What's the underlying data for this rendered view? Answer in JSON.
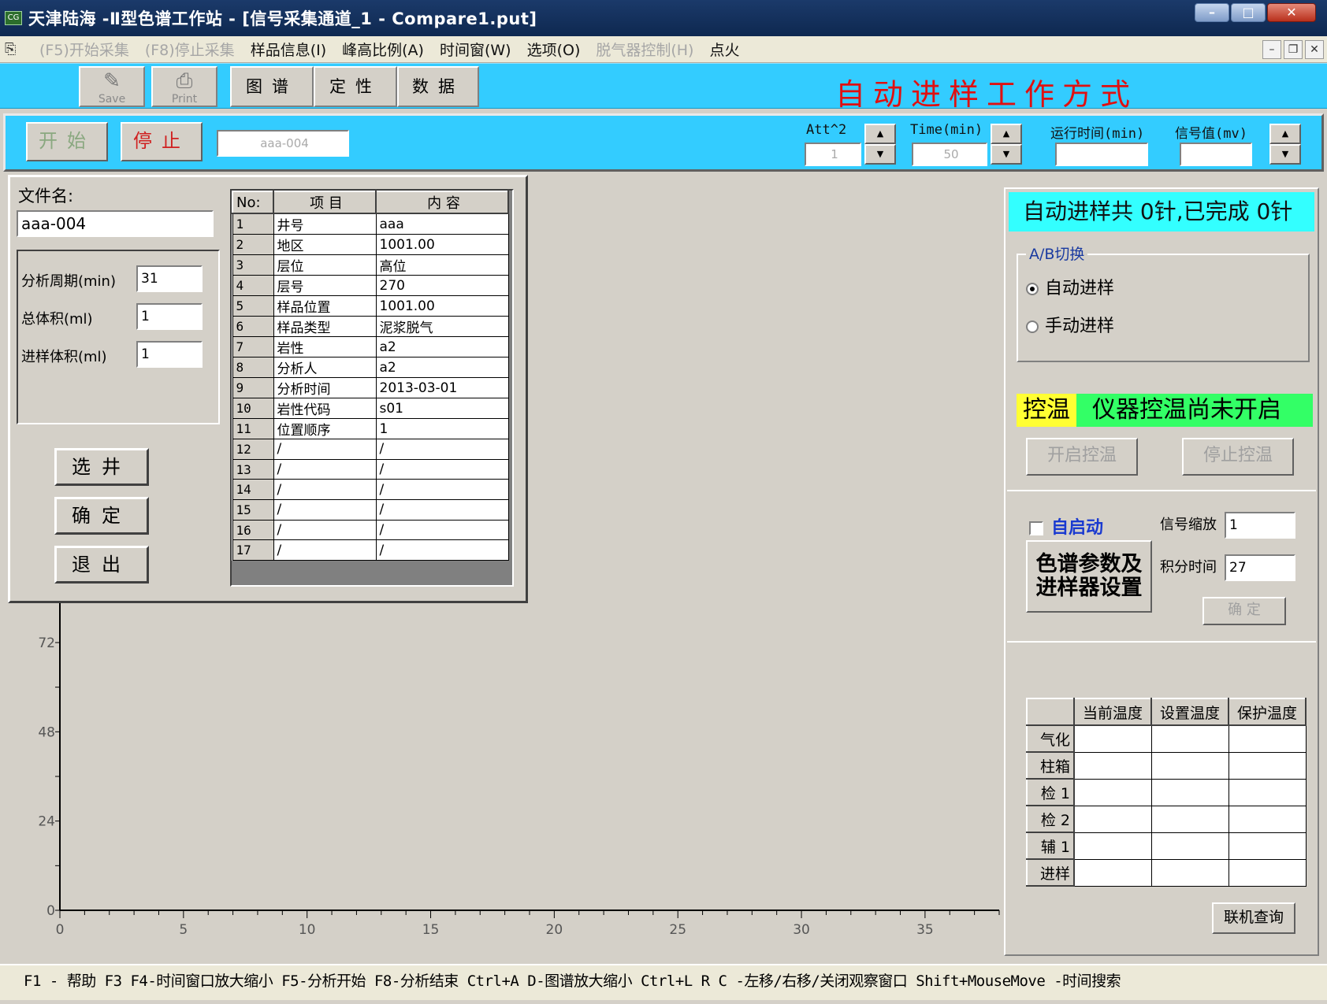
{
  "window": {
    "title": "天津陆海 -Ⅱ型色谱工作站 - [信号采集通道_1 - Compare1.put]",
    "app_icon": "CG"
  },
  "menu": {
    "items": [
      {
        "label": "(F5)开始采集",
        "disabled": true
      },
      {
        "label": "(F8)停止采集",
        "disabled": true
      },
      {
        "label": "样品信息(I)",
        "disabled": false
      },
      {
        "label": "峰高比例(A)",
        "disabled": false
      },
      {
        "label": "时间窗(W)",
        "disabled": false
      },
      {
        "label": "选项(O)",
        "disabled": false
      },
      {
        "label": "脱气器控制(H)",
        "disabled": true
      },
      {
        "label": "点火",
        "disabled": false
      }
    ]
  },
  "toolbar": {
    "save_label": "Save",
    "print_label": "Print",
    "tabs": [
      "图谱",
      "定性",
      "数据"
    ],
    "mode_title": "自动进样工作方式"
  },
  "control": {
    "start_label": "开始",
    "stop_label": "停止",
    "sample_name": "aaa-004",
    "att_label": "Att^2",
    "att_value": "1",
    "time_label": "Time(min)",
    "time_value": "50",
    "run_time_label": "运行时间(min)",
    "run_time_value": "",
    "signal_label": "信号值(mv)",
    "signal_value": ""
  },
  "file_panel": {
    "filename_label": "文件名:",
    "filename_value": "aaa-004",
    "period_label": "分析周期(min)",
    "period_value": "31",
    "total_volume_label": "总体积(ml)",
    "total_volume_value": "1",
    "inject_volume_label": "进样体积(ml)",
    "inject_volume_value": "1",
    "select_well_label": "选井",
    "confirm_label": "确定",
    "exit_label": "退出"
  },
  "info_table": {
    "headers": [
      "No:",
      "项   目",
      "内     容"
    ],
    "rows": [
      [
        "1",
        "井号",
        "aaa"
      ],
      [
        "2",
        "地区",
        "1001.00"
      ],
      [
        "3",
        "层位",
        "高位"
      ],
      [
        "4",
        "层号",
        "270"
      ],
      [
        "5",
        "样品位置",
        "1001.00"
      ],
      [
        "6",
        "样品类型",
        "泥浆脱气"
      ],
      [
        "7",
        "岩性",
        "a2"
      ],
      [
        "8",
        "分析人",
        "a2"
      ],
      [
        "9",
        "分析时间",
        "2013-03-01"
      ],
      [
        "10",
        "岩性代码",
        "s01"
      ],
      [
        "11",
        "位置顺序",
        "1"
      ],
      [
        "12",
        "/",
        "/"
      ],
      [
        "13",
        "/",
        "/"
      ],
      [
        "14",
        "/",
        "/"
      ],
      [
        "15",
        "/",
        "/"
      ],
      [
        "16",
        "/",
        "/"
      ],
      [
        "17",
        "/",
        "/"
      ]
    ]
  },
  "chart_data": {
    "type": "line",
    "x_ticks": [
      "0",
      "5",
      "10",
      "15",
      "20",
      "25",
      "30",
      "35"
    ],
    "y_ticks": [
      "0",
      "24",
      "48",
      "72"
    ],
    "xlim": [
      0,
      38
    ],
    "ylim": [
      0,
      72
    ],
    "series": []
  },
  "right_panel": {
    "progress_text": "自动进样共 0针,已完成 0针",
    "ab_group_label": "A/B切换",
    "auto_inject_label": "自动进样",
    "manual_inject_label": "手动进样",
    "auto_inject_selected": true,
    "temp_key": "控温",
    "temp_status": "仪器控温尚未开启",
    "start_temp_label": "开启控温",
    "stop_temp_label": "停止控温",
    "autostart_label": "自启动",
    "autostart_checked": false,
    "settings_label_1": "色谱参数及",
    "settings_label_2": "进样器设置",
    "signal_scale_label": "信号缩放",
    "signal_scale_value": "1",
    "integral_time_label": "积分时间",
    "integral_time_value": "27",
    "ok_label": "确 定",
    "online_query_label": "联机查询",
    "temp_table": {
      "headers": [
        "",
        "当前温度",
        "设置温度",
        "保护温度"
      ],
      "rows": [
        "气化",
        "柱箱",
        "检 1",
        "检 2",
        "辅 1",
        "进样"
      ]
    }
  },
  "statusbar": {
    "text": "F1 - 帮助  F3 F4-时间窗口放大缩小  F5-分析开始  F8-分析结束  Ctrl+A D-图谱放大缩小  Ctrl+L R C -左移/右移/关闭观察窗口  Shift+MouseMove -时间搜索"
  },
  "colors": {
    "toolbar_bg": "#33ccff",
    "mode_title": "#e01010",
    "progress_bg": "#33ffff",
    "temp_key_bg": "#ffff33",
    "temp_status_bg": "#33ff66"
  }
}
